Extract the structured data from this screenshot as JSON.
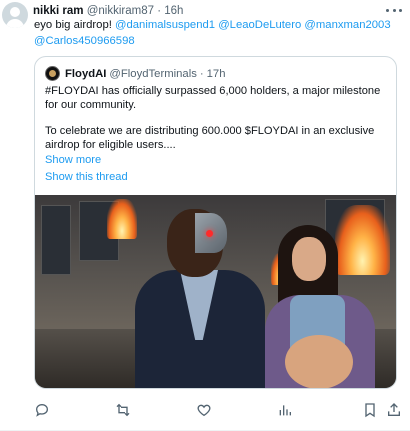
{
  "tweet": {
    "author_name": "nikki ram",
    "author_handle": "@nikkiram87",
    "separator": "·",
    "time": "16h",
    "text_prefix": "eyo big airdrop! ",
    "mentions": [
      "@danimalsuspend1",
      "@LeaoDeLutero",
      "@manxman2003",
      "@Carlos450966598"
    ]
  },
  "quote": {
    "author_name": "FloydAI",
    "author_handle": "@FloydTerminals",
    "separator": "·",
    "time": "17h",
    "paragraph1": "#FLOYDAI has officially surpassed 6,000 holders, a major milestone for our community.",
    "paragraph2": "To celebrate we are distributing 600.000 $FLOYDAI in an exclusive airdrop for eligible users....",
    "show_more": "Show more",
    "show_thread": "Show this thread"
  },
  "actions": {
    "icons": [
      "reply-icon",
      "retweet-icon",
      "like-icon",
      "views-icon",
      "bookmark-icon",
      "share-icon"
    ]
  },
  "colors": {
    "link": "#1d9bf0",
    "secondary_text": "#536471",
    "border": "#cfd9de"
  }
}
